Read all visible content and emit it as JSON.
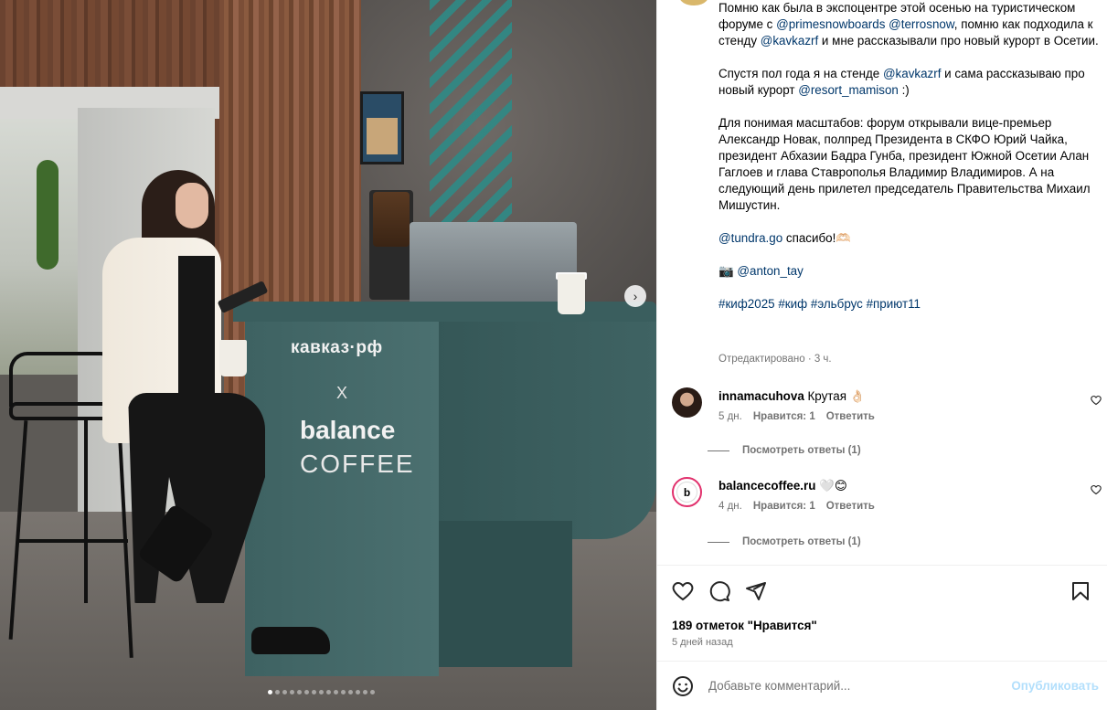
{
  "post": {
    "caption": {
      "para1": [
        {
          "t": "Помню как была в экспоцентре этой осенью на туристическом форуме с "
        },
        {
          "t": "@primesnowboards",
          "m": true
        },
        {
          "t": " "
        },
        {
          "t": "@terrosnow",
          "m": true
        },
        {
          "t": ", помню как подходила к стенду "
        },
        {
          "t": "@kavkazrf",
          "m": true
        },
        {
          "t": " и мне рассказывали про новый курорт в Осетии."
        }
      ],
      "para2": [
        {
          "t": "Спустя пол года я на стенде "
        },
        {
          "t": "@kavkazrf",
          "m": true
        },
        {
          "t": " и сама рассказываю про новый курорт "
        },
        {
          "t": "@resort_mamison",
          "m": true
        },
        {
          "t": " :)"
        }
      ],
      "para3": [
        {
          "t": "Для понимая масштабов: форум открывали вице-премьер Александр Новак, полпред Президента в СКФО Юрий Чайка, президент Абхазии Бадра Гунба, президент Южной Осетии Алан Гаглоев и глава Ставрополья Владимир Владимиров. А на следующий день прилетел председатель Правительства Михаил Мишустин."
        }
      ],
      "para4": [
        {
          "t": "@tundra.go",
          "m": true
        },
        {
          "t": " спасибо!🫶🏻"
        }
      ],
      "para5": [
        {
          "t": "📷 "
        },
        {
          "t": "@anton_tay",
          "m": true
        }
      ],
      "hashtags": [
        {
          "t": "#киф2025",
          "m": true
        },
        {
          "t": " "
        },
        {
          "t": "#киф",
          "m": true
        },
        {
          "t": " "
        },
        {
          "t": "#эльбрус",
          "m": true
        },
        {
          "t": " "
        },
        {
          "t": "#приют11",
          "m": true
        }
      ]
    },
    "edited_label": "Отредактировано · 3 ч.",
    "likes_label": "189 отметок \"Нравится\"",
    "time_ago": "5 дней назад",
    "carousel": {
      "slide_count": 15,
      "active_index": 0
    }
  },
  "photo_text": {
    "kavkaz": "кавказ·рф",
    "x": "X",
    "balance": "balance",
    "coffee": "COFFEE"
  },
  "comments": [
    {
      "user": "innamacuhova",
      "text": "Крутая 👌🏻",
      "age": "5 дн.",
      "likes": "Нравится: 1",
      "reply": "Ответить",
      "view_replies": "Посмотреть ответы (1)"
    },
    {
      "user": "balancecoffee.ru",
      "text": "🤍😊",
      "age": "4 дн.",
      "likes": "Нравится: 1",
      "reply": "Ответить",
      "view_replies": "Посмотреть ответы (1)",
      "avatar_letter": "b"
    }
  ],
  "composer": {
    "placeholder": "Добавьте комментарий...",
    "publish_label": "Опубликовать"
  },
  "colors": {
    "mention": "#00376b",
    "muted": "#737373",
    "publish_disabled": "#b2dffc",
    "counter_teal": "#3e6262"
  },
  "icons": [
    "heart-icon",
    "comment-icon",
    "share-icon",
    "bookmark-icon",
    "emoji-icon",
    "chevron-right-icon"
  ]
}
